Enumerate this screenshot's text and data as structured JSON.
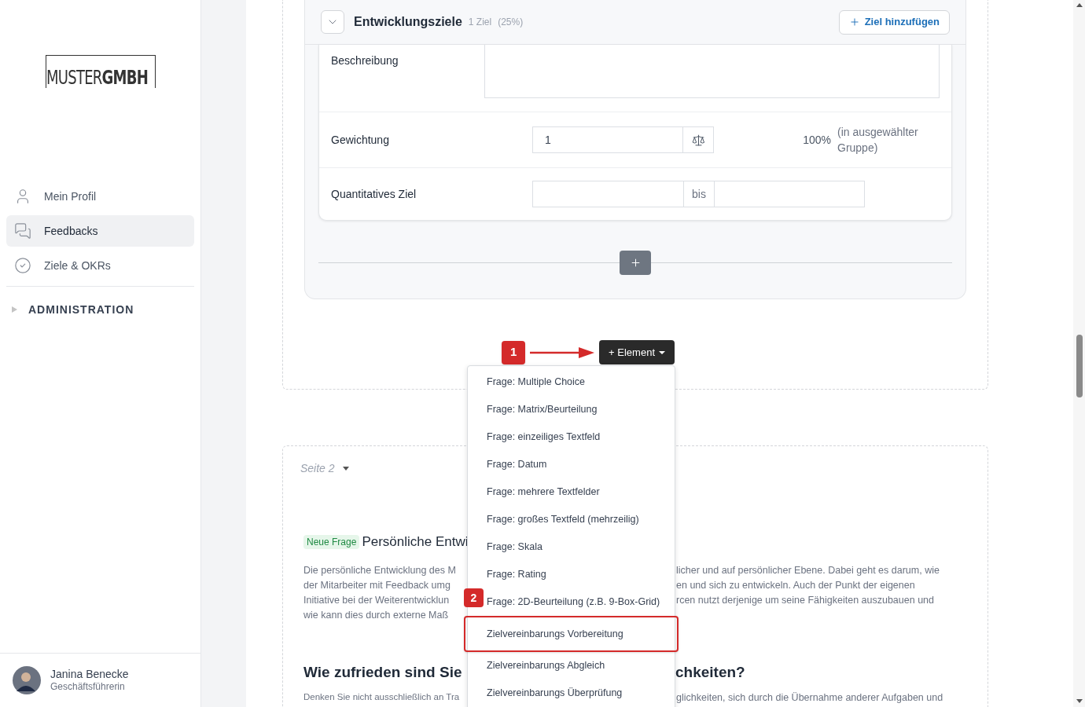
{
  "sidebar": {
    "logo": {
      "light": "MUSTER",
      "bold": "GMBH"
    },
    "items": [
      {
        "kind": "person",
        "label": "Mein Profil",
        "selected": false
      },
      {
        "kind": "chat",
        "label": "Feedbacks",
        "selected": true
      },
      {
        "kind": "check",
        "label": "Ziele & OKRs",
        "selected": false
      }
    ],
    "section": {
      "label": "ADMINISTRATION",
      "expanded": false
    },
    "user": {
      "name": "Janina Benecke",
      "role": "Geschäftsführerin"
    }
  },
  "goal_group": {
    "title": "Entwicklungsziele",
    "count": "1 Ziel",
    "percent": "(25%)",
    "add_button": "Ziel hinzufügen",
    "fields": [
      {
        "kind": "textarea",
        "label": "Beschreibung"
      },
      {
        "kind": "weight",
        "label": "Gewichtung",
        "value": "1",
        "percent": "100%",
        "note": "(in ausgewählter Gruppe)"
      },
      {
        "kind": "range",
        "label": "Quantitatives Ziel",
        "separator": "bis"
      }
    ]
  },
  "element_button": "+ Element",
  "menu": [
    {
      "label": "Frage: Multiple Choice",
      "highlighted": false
    },
    {
      "label": "Frage: Matrix/Beurteilung",
      "highlighted": false
    },
    {
      "label": "Frage: einzeiliges Textfeld",
      "highlighted": false
    },
    {
      "label": "Frage: Datum",
      "highlighted": false
    },
    {
      "label": "Frage: mehrere Textfelder",
      "highlighted": false
    },
    {
      "label": "Frage: großes Textfeld (mehrzeilig)",
      "highlighted": false
    },
    {
      "label": "Frage: Skala",
      "highlighted": false
    },
    {
      "label": "Frage: Rating",
      "highlighted": false
    },
    {
      "label": "Frage: 2D-Beurteilung (z.B. 9-Box-Grid)",
      "highlighted": false
    },
    {
      "label": "Zielvereinbarungs Vorbereitung",
      "highlighted": true
    },
    {
      "label": "Zielvereinbarungs Abgleich",
      "highlighted": false
    },
    {
      "label": "Zielvereinbarungs Überprüfung",
      "highlighted": false
    }
  ],
  "badges": [
    "1",
    "2"
  ],
  "page_2": {
    "label": "Seite 2",
    "badge": "Neue Frage",
    "question_title": "Persönliche Entwi",
    "description_left": [
      "Die persönliche Entwicklung des M",
      "der Mitarbeiter mit Feedback umg",
      "Initiative bei der Weiterentwicklun",
      "wie kann dies durch externe Maß"
    ],
    "description_right": [
      "licher und auf persönlicher Ebene. Dabei geht es darum, wie",
      "en und sich zu entwickeln. Auch der Punkt der eigenen",
      "rcen nutzt derjenige um seine Fähigkeiten auszubauen und"
    ],
    "heading_left": "Wie zufrieden sind Sie",
    "heading_right": "chkeiten?",
    "text_left": "Denken Sie nicht ausschließlich an Tra",
    "text_right": "glichkeiten, sich durch die Übernahme anderer Aufgaben und"
  }
}
